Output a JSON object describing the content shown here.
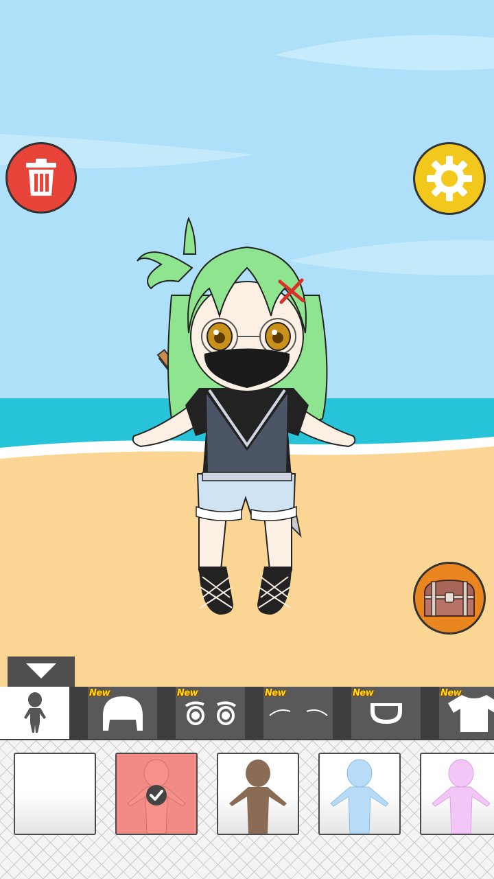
{
  "buttons": {
    "delete_icon": "trash-icon",
    "settings_icon": "gear-icon",
    "chest_icon": "treasure-chest-icon",
    "collapse_icon": "triangle-down-icon"
  },
  "category_tabs": [
    {
      "id": "body",
      "icon": "body-silhouette-icon",
      "badge": ""
    },
    {
      "id": "hair",
      "icon": "hair-icon",
      "badge": "New"
    },
    {
      "id": "eyes",
      "icon": "eyes-icon",
      "badge": "New"
    },
    {
      "id": "eyebrows",
      "icon": "eyebrows-icon",
      "badge": "New"
    },
    {
      "id": "mouth",
      "icon": "mouth-icon",
      "badge": "New"
    },
    {
      "id": "clothes",
      "icon": "shirt-icon",
      "badge": "New"
    }
  ],
  "body_options": [
    {
      "color": "#ffffff",
      "selected": false
    },
    {
      "color": "#f5908a",
      "selected": true
    },
    {
      "color": "#8a6b55",
      "selected": false
    },
    {
      "color": "#b8dcf7",
      "selected": false
    },
    {
      "color": "#f2c6f7",
      "selected": false
    }
  ],
  "colors": {
    "sky": "#aee0fa",
    "sea": "#26c3d9",
    "sand": "#fbd594",
    "hair": "#8fe58f",
    "delete": "#e8443a",
    "settings": "#f3c81d",
    "chest": "#ea8620",
    "selected_card": "#f28b86"
  }
}
